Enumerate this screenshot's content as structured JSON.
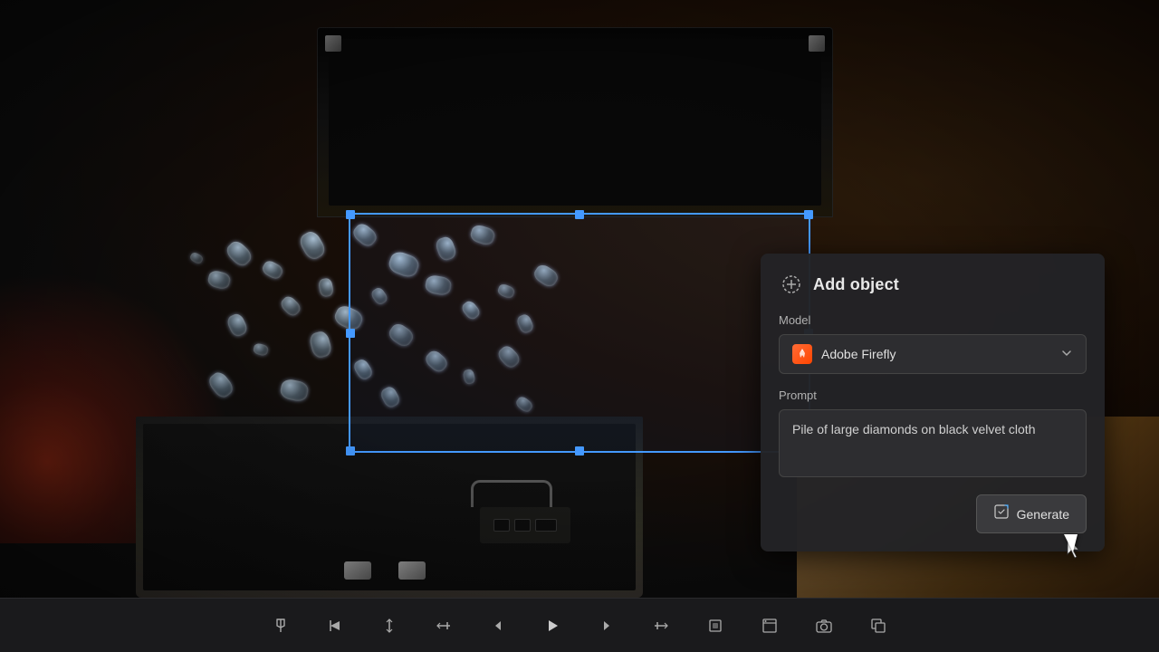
{
  "panel": {
    "title": "Add object",
    "model_label": "Model",
    "prompt_label": "Prompt",
    "model_name": "Adobe Firefly",
    "prompt_value": "Pile of large diamonds on black velvet cloth",
    "generate_label": "Generate"
  },
  "toolbar": {
    "buttons": [
      {
        "name": "marker-tool",
        "label": "◆"
      },
      {
        "name": "bracket-left-tool",
        "label": "❮"
      },
      {
        "name": "vertical-split-tool",
        "label": "⇕"
      },
      {
        "name": "expand-left-tool",
        "label": "⟵"
      },
      {
        "name": "prev-frame",
        "label": "◁"
      },
      {
        "name": "play-pause",
        "label": "▶"
      },
      {
        "name": "next-frame",
        "label": "▷"
      },
      {
        "name": "expand-right-tool",
        "label": "⟶"
      },
      {
        "name": "fit-frame-tool",
        "label": "⊡"
      },
      {
        "name": "fit-window-tool",
        "label": "⊟"
      },
      {
        "name": "camera-tool",
        "label": "⊙"
      },
      {
        "name": "export-tool",
        "label": "⊞"
      }
    ]
  },
  "colors": {
    "accent_blue": "#4499ff",
    "panel_bg": "#232326",
    "btn_bg": "#3a3a3d",
    "generate_btn_bg": "#3a3a3d"
  }
}
